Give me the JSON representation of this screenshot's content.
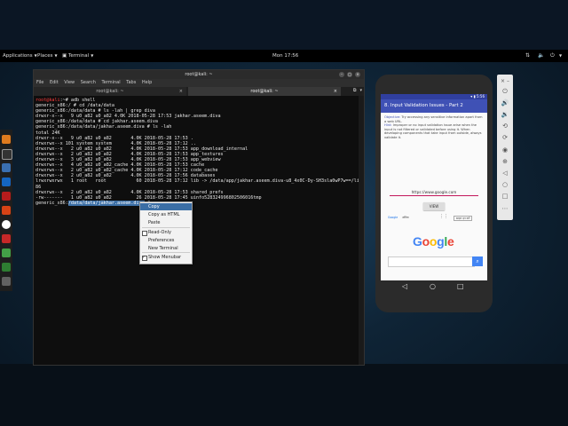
{
  "topbar": {
    "applications": "Applications",
    "places": "Places",
    "terminal": "Terminal",
    "clock": "Mon 17:56"
  },
  "terminal": {
    "title": "root@kali: ~",
    "menu": [
      "File",
      "Edit",
      "View",
      "Search",
      "Terminal",
      "Tabs",
      "Help"
    ],
    "tabs": [
      {
        "label": "root@kali: ~",
        "active": false
      },
      {
        "label": "root@kali: ~",
        "active": true
      }
    ],
    "lines": [
      {
        "text": "root@kali:~# adb shell",
        "color": "red-prefix"
      },
      {
        "text": "generic_x86:/ # cd /data/data"
      },
      {
        "text": "generic_x86:/data/data # ls -lah | grep diva"
      },
      {
        "text": "drwxr-x--x   9 u0_a82 u0_a82 4.0K 2018-05-28 17:53 jakhar.aseem.diva"
      },
      {
        "text": "generic_x86:/data/data # cd jakhar.aseem.diva"
      },
      {
        "text": "generic_x86:/data/data/jakhar.aseem.diva # ls -lah"
      },
      {
        "text": "total 24K"
      },
      {
        "text": "drwxr-x--x   9 u0_a82 u0_a82       4.0K 2018-05-28 17:53 ."
      },
      {
        "text": "drwxrwx--x 101 system system       4.0K 2018-05-28 17:12 .."
      },
      {
        "text": "drwxrwx--x   2 u0_a82 u0_a82       4.0K 2018-05-28 17:53 app_download_internal"
      },
      {
        "text": "drwxrwx--x   2 u0_a82 u0_a82       4.0K 2018-05-28 17:53 app_textures"
      },
      {
        "text": "drwxrwx--x   3 u0_a82 u0_a82       4.0K 2018-05-28 17:53 app_webview"
      },
      {
        "text": "drwxrws--x   4 u0_a82 u0_a82_cache 4.0K 2018-05-28 17:53 cache"
      },
      {
        "text": "drwxrws--x   2 u0_a82 u0_a82_cache 4.0K 2018-05-28 17:12 code_cache"
      },
      {
        "text": "drwxrwx--x   2 u0_a82 u0_a82       4.0K 2018-05-28 17:56 databases"
      },
      {
        "text": "lrwxrwxrwx   1 root   root           60 2018-05-28 17:12 lib -> /data/app/jakhar.aseem.diva-u8_4x0C-Dy-SH3sla0wP7w==/lib/x"
      },
      {
        "text": "86"
      },
      {
        "text": "drwxrwx--x   2 u0_a82 u0_a82       4.0K 2018-05-28 17:53 shared_prefs"
      },
      {
        "text": "-rw-------   1 u0_a82 u0_a82         26 2018-05-28 17:45 uinfo528324996802506016tmp"
      }
    ],
    "prompt_prefix": "generic_x86:",
    "prompt_selected": "/data/data/jakhar.aseem.diva",
    "prompt_suffix": " #"
  },
  "context_menu": {
    "items": [
      {
        "label": "Copy",
        "selected": true
      },
      {
        "label": "Copy as HTML"
      },
      {
        "label": "Paste"
      },
      {
        "label": "Read-Only",
        "check": true
      },
      {
        "label": "Preferences"
      },
      {
        "label": "New Terminal"
      },
      {
        "label": "Show Menubar",
        "check": true,
        "checked": true
      }
    ]
  },
  "emulator": {
    "status_time": "5:56",
    "app_title": "8. Input Validation Issues - Part 2",
    "objective_label": "Objective:",
    "objective_text": "Try accessing any sensitive information apart from a web URL.",
    "hint_label": "Hint:",
    "hint_text": "Improper or no input validation issue arise when the input is not filtered or validated before using it. When developing components that take input from outside, always validate it.",
    "url_value": "https://www.google.com",
    "view_button": "VIEW",
    "web_tabs": [
      "Google",
      "अधिक",
      "",
      "साइन इन करें"
    ],
    "google_letters": [
      {
        "ch": "G",
        "color": "#4285f4"
      },
      {
        "ch": "o",
        "color": "#ea4335"
      },
      {
        "ch": "o",
        "color": "#fbbc05"
      },
      {
        "ch": "g",
        "color": "#4285f4"
      },
      {
        "ch": "l",
        "color": "#34a853"
      },
      {
        "ch": "e",
        "color": "#ea4335"
      }
    ]
  }
}
